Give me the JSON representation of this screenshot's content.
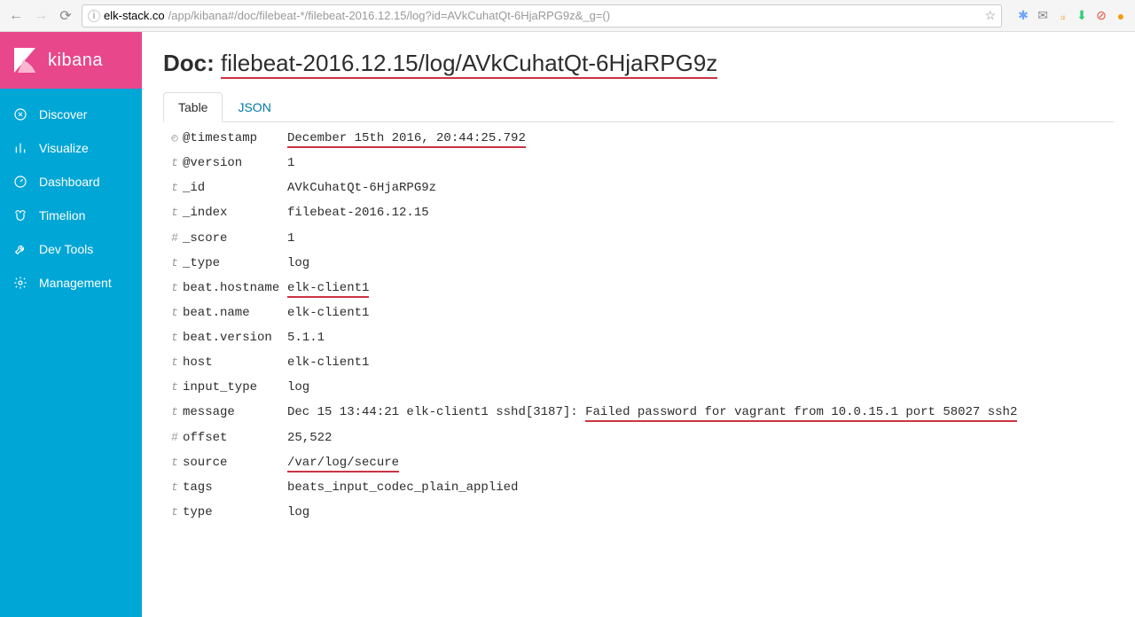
{
  "browser": {
    "url_host": "elk-stack.co",
    "url_path": "/app/kibana#/doc/filebeat-*/filebeat-2016.12.15/log?id=AVkCuhatQt-6HjaRPG9z&_g=()"
  },
  "sidebar": {
    "brand": "kibana",
    "items": [
      {
        "label": "Discover"
      },
      {
        "label": "Visualize"
      },
      {
        "label": "Dashboard"
      },
      {
        "label": "Timelion"
      },
      {
        "label": "Dev Tools"
      },
      {
        "label": "Management"
      }
    ]
  },
  "doc": {
    "title_prefix": "Doc: ",
    "title_id": "filebeat-2016.12.15/log/AVkCuhatQt-6HjaRPG9z",
    "tabs": {
      "table": "Table",
      "json": "JSON"
    },
    "fields": [
      {
        "type": "clock",
        "name": "@timestamp",
        "value": "December 15th 2016, 20:44:25.792",
        "underline": true
      },
      {
        "type": "t",
        "name": "@version",
        "value": "1"
      },
      {
        "type": "t",
        "name": "_id",
        "value": "AVkCuhatQt-6HjaRPG9z"
      },
      {
        "type": "t",
        "name": "_index",
        "value": "filebeat-2016.12.15"
      },
      {
        "type": "#",
        "name": "_score",
        "value": "1"
      },
      {
        "type": "t",
        "name": "_type",
        "value": "log"
      },
      {
        "type": "t",
        "name": "beat.hostname",
        "value": "elk-client1",
        "underline": true
      },
      {
        "type": "t",
        "name": "beat.name",
        "value": "elk-client1"
      },
      {
        "type": "t",
        "name": "beat.version",
        "value": "5.1.1"
      },
      {
        "type": "t",
        "name": "host",
        "value": "elk-client1"
      },
      {
        "type": "t",
        "name": "input_type",
        "value": "log"
      },
      {
        "type": "t",
        "name": "message",
        "value": "Dec 15 13:44:21 elk-client1 sshd[3187]: ",
        "value_underlined": "Failed password for vagrant from 10.0.15.1 port 58027 ssh2"
      },
      {
        "type": "#",
        "name": "offset",
        "value": "25,522"
      },
      {
        "type": "t",
        "name": "source",
        "value": "/var/log/secure",
        "underline": true
      },
      {
        "type": "t",
        "name": "tags",
        "value": "beats_input_codec_plain_applied"
      },
      {
        "type": "t",
        "name": "type",
        "value": "log"
      }
    ]
  }
}
